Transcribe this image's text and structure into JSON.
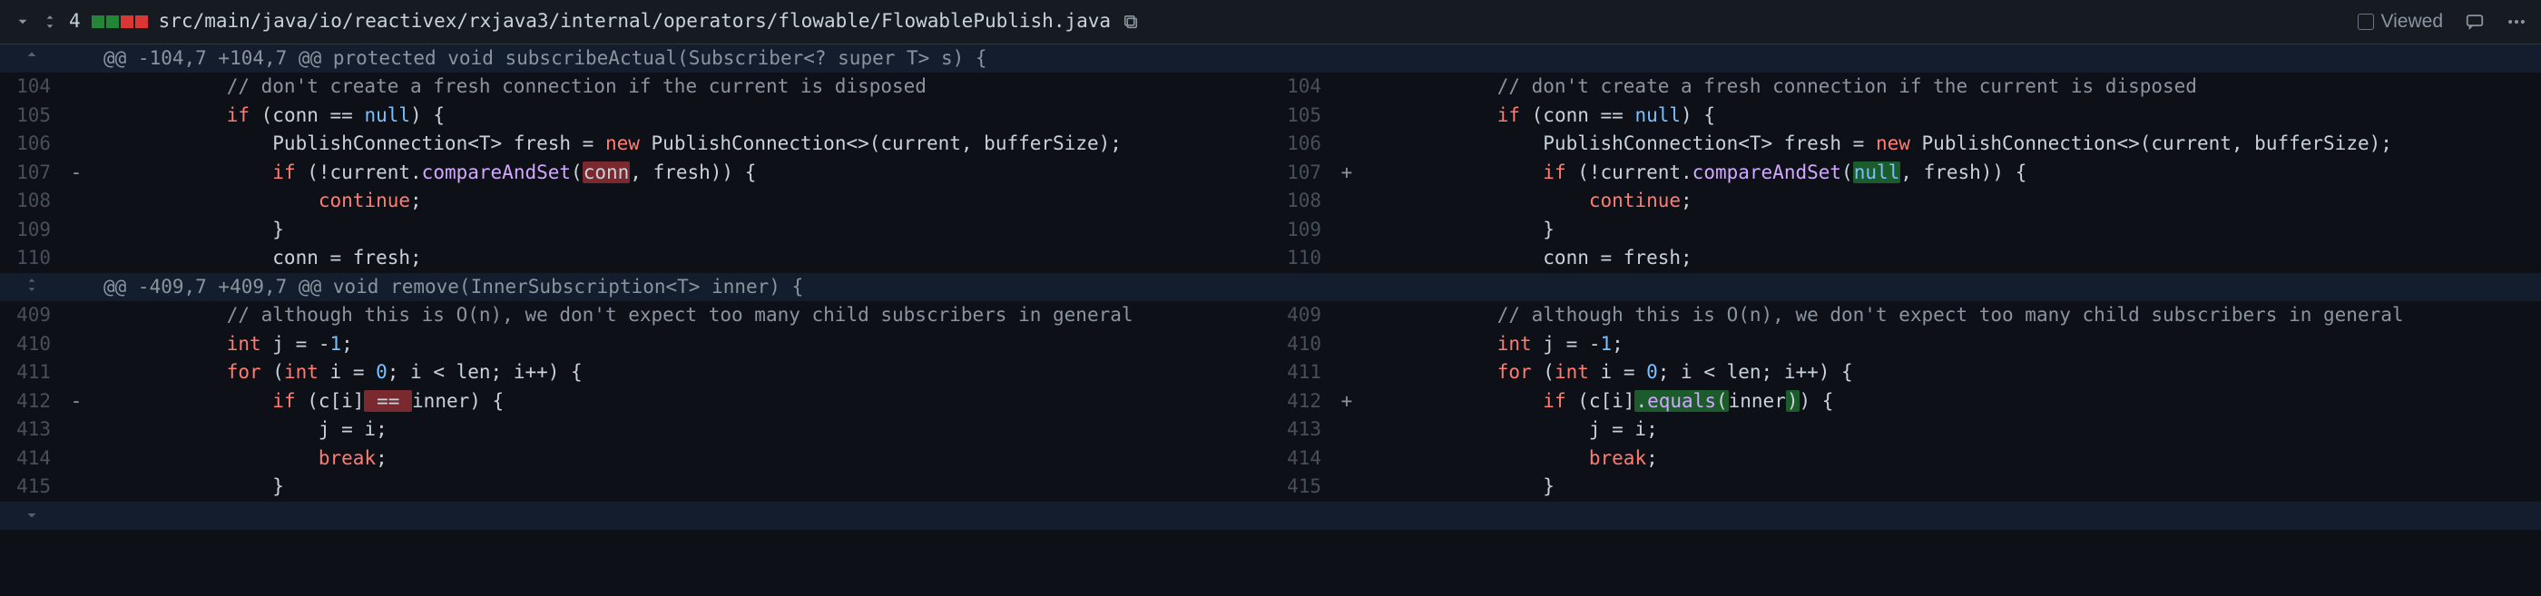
{
  "header": {
    "file_count": "4",
    "path": "src/main/java/io/reactivex/rxjava3/internal/operators/flowable/FlowablePublish.java",
    "viewed_label": "Viewed"
  },
  "hunks": [
    {
      "header": "@@ -104,7 +104,7 @@ protected void subscribeActual(Subscriber<? super T> s) {",
      "lines": [
        {
          "ln_l": "104",
          "ln_r": "104",
          "type": "ctx",
          "l_html": "            <span class='tok-cmt'>// don't create a fresh connection if the current is disposed</span>",
          "r_html": "            <span class='tok-cmt'>// don't create a fresh connection if the current is disposed</span>"
        },
        {
          "ln_l": "105",
          "ln_r": "105",
          "type": "ctx",
          "l_html": "            <span class='tok-kw'>if</span> (conn == <span class='tok-null'>null</span>) {",
          "r_html": "            <span class='tok-kw'>if</span> (conn == <span class='tok-null'>null</span>) {"
        },
        {
          "ln_l": "106",
          "ln_r": "106",
          "type": "ctx",
          "l_html": "                PublishConnection&lt;T&gt; fresh = <span class='tok-kw'>new</span> PublishConnection&lt;&gt;(current, bufferSize);",
          "r_html": "                PublishConnection&lt;T&gt; fresh = <span class='tok-kw'>new</span> PublishConnection&lt;&gt;(current, bufferSize);"
        },
        {
          "ln_l": "107",
          "ln_r": "107",
          "type": "chg",
          "l_html": "                <span class='tok-kw'>if</span> (!current.<span class='tok-fn'>compareAndSet</span>(<span class='hl-del'>conn</span>, fresh)) {",
          "r_html": "                <span class='tok-kw'>if</span> (!current.<span class='tok-fn'>compareAndSet</span>(<span class='hl-add'><span class='tok-null'>null</span></span>, fresh)) {"
        },
        {
          "ln_l": "108",
          "ln_r": "108",
          "type": "ctx",
          "l_html": "                    <span class='tok-kw'>continue</span>;",
          "r_html": "                    <span class='tok-kw'>continue</span>;",
          "bubble": true
        },
        {
          "ln_l": "109",
          "ln_r": "109",
          "type": "ctx",
          "l_html": "                }",
          "r_html": "                }"
        },
        {
          "ln_l": "110",
          "ln_r": "110",
          "type": "ctx",
          "l_html": "                conn = fresh;",
          "r_html": "                conn = fresh;"
        }
      ]
    },
    {
      "header": "@@ -409,7 +409,7 @@ void remove(InnerSubscription<T> inner) {",
      "lines": [
        {
          "ln_l": "409",
          "ln_r": "409",
          "type": "ctx",
          "l_html": "            <span class='tok-cmt'>// although this is O(n), we don't expect too many child subscribers in general</span>",
          "r_html": "            <span class='tok-cmt'>// although this is O(n), we don't expect too many child subscribers in general</span>"
        },
        {
          "ln_l": "410",
          "ln_r": "410",
          "type": "ctx",
          "l_html": "            <span class='tok-kw'>int</span> j = -<span class='tok-num'>1</span>;",
          "r_html": "            <span class='tok-kw'>int</span> j = -<span class='tok-num'>1</span>;"
        },
        {
          "ln_l": "411",
          "ln_r": "411",
          "type": "ctx",
          "l_html": "            <span class='tok-kw'>for</span> (<span class='tok-kw'>int</span> i = <span class='tok-num'>0</span>; i &lt; len; i++) {",
          "r_html": "            <span class='tok-kw'>for</span> (<span class='tok-kw'>int</span> i = <span class='tok-num'>0</span>; i &lt; len; i++) {"
        },
        {
          "ln_l": "412",
          "ln_r": "412",
          "type": "chg",
          "l_html": "                <span class='tok-kw'>if</span> (c[i]<span class='hl-del'> == </span>inner) {",
          "r_html": "                <span class='tok-kw'>if</span> (c[i]<span class='hl-add'>.<span class='tok-fn'>equals</span>(</span>inner<span class='hl-add'>)</span>) {"
        },
        {
          "ln_l": "413",
          "ln_r": "413",
          "type": "ctx",
          "l_html": "                    j = i;",
          "r_html": "                    j = i;"
        },
        {
          "ln_l": "414",
          "ln_r": "414",
          "type": "ctx",
          "l_html": "                    <span class='tok-kw'>break</span>;",
          "r_html": "                    <span class='tok-kw'>break</span>;"
        },
        {
          "ln_l": "415",
          "ln_r": "415",
          "type": "ctx",
          "l_html": "                }",
          "r_html": "                }"
        }
      ]
    }
  ]
}
